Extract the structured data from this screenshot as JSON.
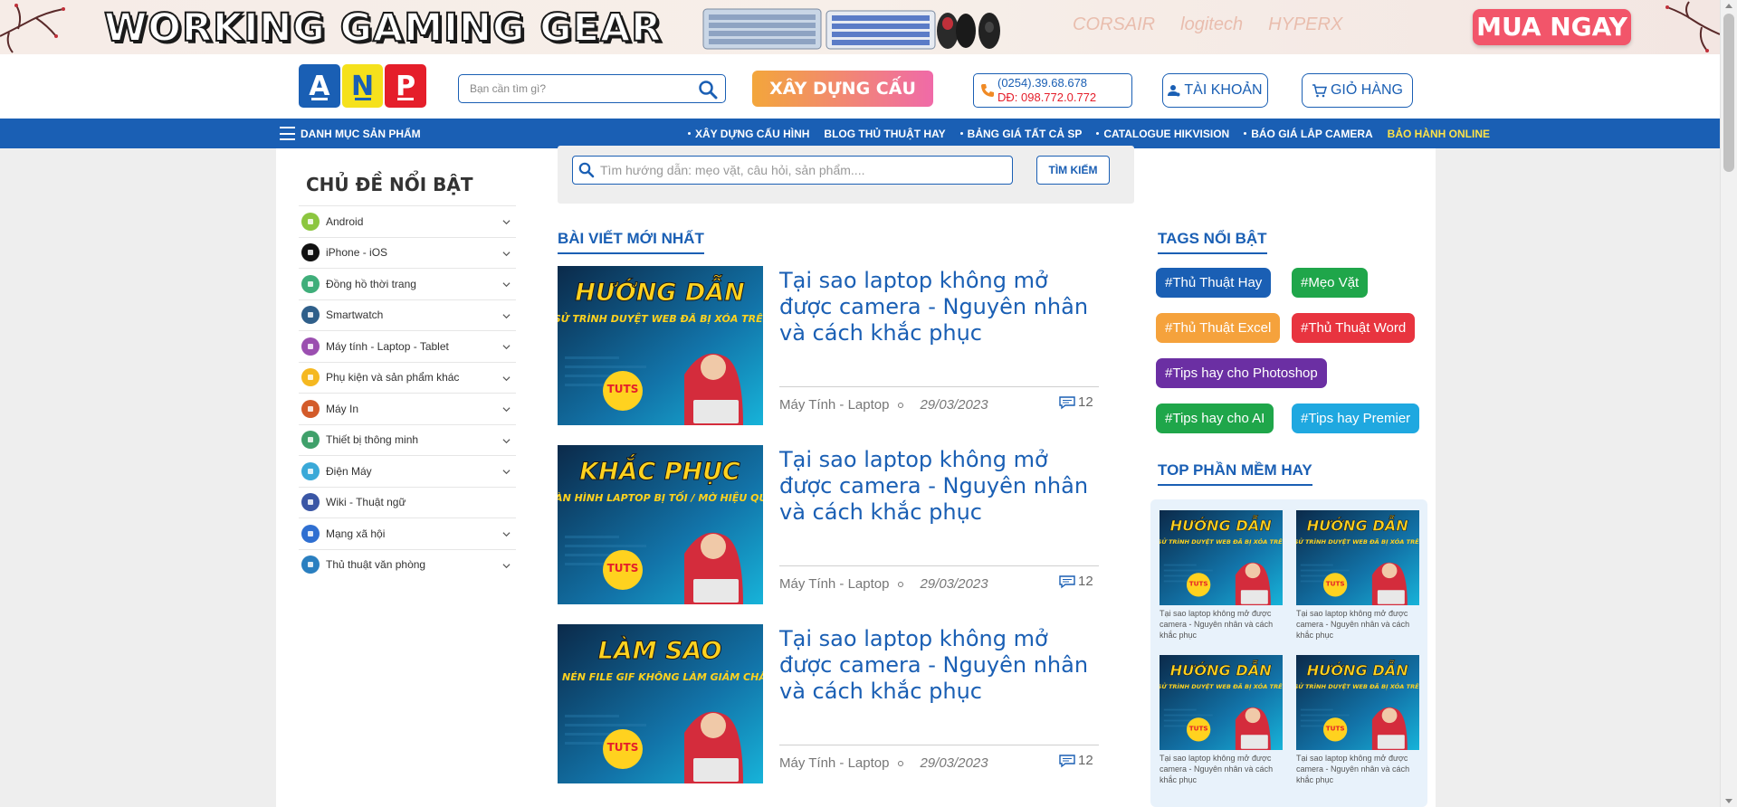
{
  "banner": {
    "title": "WORKING GAMING GEAR",
    "brands": [
      "CORSAIR",
      "logitech",
      "HYPERX"
    ],
    "buy_label": "MUA NGAY"
  },
  "header": {
    "logo_letters": [
      "A",
      "N",
      "P"
    ],
    "search_placeholder": "Bạn cần tìm gì?",
    "build_label": "XÂY DỰNG CẤU HÌNH",
    "phone_line1": "(0254).39.68.678",
    "phone_line2": "DĐ: 098.772.0.772",
    "account_label": "TÀI KHOẢN",
    "cart_label": "GIỎ HÀNG"
  },
  "nav": {
    "category_label": "DANH MỤC SẢN PHẨM",
    "links": [
      {
        "label": "XÂY DỰNG CẤU HÌNH",
        "highlight": false
      },
      {
        "label": "BLOG THỦ THUẬT HAY",
        "highlight": false
      },
      {
        "label": "BẢNG GIÁ TẤT CẢ SP",
        "highlight": false
      },
      {
        "label": "CATALOGUE HIKVISION",
        "highlight": false
      },
      {
        "label": "BÁO GIÁ LẮP CAMERA",
        "highlight": false
      },
      {
        "label": "BẢO HÀNH ONLINE",
        "highlight": true
      }
    ]
  },
  "sidebar": {
    "title": "CHỦ ĐỀ NỔI BẬT",
    "items": [
      {
        "label": "Android",
        "icon": "android-icon",
        "color": "#8cc63f",
        "chevron": true
      },
      {
        "label": "iPhone - iOS",
        "icon": "apple-icon",
        "color": "#111111",
        "chevron": true
      },
      {
        "label": "Đồng hồ thời trang",
        "icon": "watch-icon",
        "color": "#3fae7a",
        "chevron": true
      },
      {
        "label": "Smartwatch",
        "icon": "smartwatch-icon",
        "color": "#2f5f8a",
        "chevron": true
      },
      {
        "label": "Máy tính - Laptop - Tablet",
        "icon": "laptop-icon",
        "color": "#9b4fb0",
        "chevron": true
      },
      {
        "label": "Phụ kiện và sản phẩm khác",
        "icon": "bulb-icon",
        "color": "#f5b820",
        "chevron": true
      },
      {
        "label": "Máy In",
        "icon": "printer-icon",
        "color": "#d35b2a",
        "chevron": true
      },
      {
        "label": "Thiết bị thông minh",
        "icon": "smart-device-icon",
        "color": "#3fa06a",
        "chevron": true
      },
      {
        "label": "Điện Máy",
        "icon": "appliance-icon",
        "color": "#3aa9d8",
        "chevron": true
      },
      {
        "label": "Wiki - Thuật ngữ",
        "icon": "book-icon",
        "color": "#3a56a5",
        "chevron": false
      },
      {
        "label": "Mạng xã hội",
        "icon": "social-icon",
        "color": "#2f6fd1",
        "chevron": true
      },
      {
        "label": "Thủ thuật văn phòng",
        "icon": "document-icon",
        "color": "#2a7fc0",
        "chevron": true
      }
    ]
  },
  "content_search": {
    "placeholder": "Tìm hướng dẫn: mẹo vặt, câu hỏi, sản phẩm....",
    "button_label": "TÌM KIẾM"
  },
  "latest": {
    "title": "BÀI VIẾT MỚI NHẤT",
    "posts": [
      {
        "title": "Tại sao laptop không mở được camera - Nguyên nhân và cách khắc phục",
        "category": "Máy Tính - Laptop",
        "date": "29/03/2023",
        "comments": "12",
        "thumb_big": "HƯỚNG DẪN",
        "thumb_small": "XEM LỊCH SỬ TRÌNH DUYỆT WEB ĐÃ BỊ XÓA TRÊN CHROME",
        "thumb_badge": "TUTS"
      },
      {
        "title": "Tại sao laptop không mở được camera - Nguyên nhân và cách khắc phục",
        "category": "Máy Tính - Laptop",
        "date": "29/03/2023",
        "comments": "12",
        "thumb_big": "KHẮC PHỤC",
        "thumb_small": "MÀN HÌNH LAPTOP BỊ TỐI / MỜ HIỆU QUẢ",
        "thumb_badge": "TUTS"
      },
      {
        "title": "Tại sao laptop không mở được camera - Nguyên nhân và cách khắc phục",
        "category": "Máy Tính - Laptop",
        "date": "29/03/2023",
        "comments": "12",
        "thumb_big": "LÀM SAO",
        "thumb_small": "NÉN ẢNH, NÉN FILE GIF KHÔNG LÀM GIẢM CHẤT LƯỢNG",
        "thumb_badge": "TUTS"
      }
    ]
  },
  "tags": {
    "title": "TAGS NỔI BẬT",
    "items": [
      {
        "label": "#Thủ Thuật Hay",
        "color": "#1a5fb4"
      },
      {
        "label": "#Mẹo Vặt",
        "color": "#1fa64a"
      },
      {
        "label": "#Thủ Thuật Excel",
        "color": "#f5a23c"
      },
      {
        "label": "#Thủ Thuật Word",
        "color": "#e8343f"
      },
      {
        "label": "#Tips hay cho Photoshop",
        "color": "#6b2fa3"
      },
      {
        "label": "#Tips hay cho AI",
        "color": "#1fa64a"
      },
      {
        "label": "#Tips hay Premier",
        "color": "#1fa8e0"
      }
    ]
  },
  "top_apps": {
    "title": "TOP PHẦN MỀM HAY",
    "items": [
      {
        "caption": "Tại sao laptop không mở được camera - Nguyên nhân và cách khắc phục",
        "thumb_big": "HƯỚNG DẪN",
        "thumb_small": "XEM LỊCH SỬ TRÌNH DUYỆT WEB ĐÃ BỊ XÓA TRÊN CHROME",
        "thumb_badge": "TUTS"
      },
      {
        "caption": "Tại sao laptop không mở được camera - Nguyên nhân và cách khắc phục",
        "thumb_big": "HƯỚNG DẪN",
        "thumb_small": "XEM LỊCH SỬ TRÌNH DUYỆT WEB ĐÃ BỊ XÓA TRÊN CHROME",
        "thumb_badge": "TUTS"
      },
      {
        "caption": "Tại sao laptop không mở được camera - Nguyên nhân và cách khắc phục",
        "thumb_big": "HƯỚNG DẪN",
        "thumb_small": "XEM LỊCH SỬ TRÌNH DUYỆT WEB ĐÃ BỊ XÓA TRÊN CHROME",
        "thumb_badge": "TUTS"
      },
      {
        "caption": "Tại sao laptop không mở được camera - Nguyên nhân và cách khắc phục",
        "thumb_big": "HƯỚNG DẪN",
        "thumb_small": "XEM LỊCH SỬ TRÌNH DUYỆT WEB ĐÃ BỊ XÓA TRÊN CHROME",
        "thumb_badge": "TUTS"
      }
    ]
  },
  "colors": {
    "brand_blue": "#1a5fb4",
    "nav_highlight": "#ffe347",
    "buy_button": "#f2556a"
  }
}
